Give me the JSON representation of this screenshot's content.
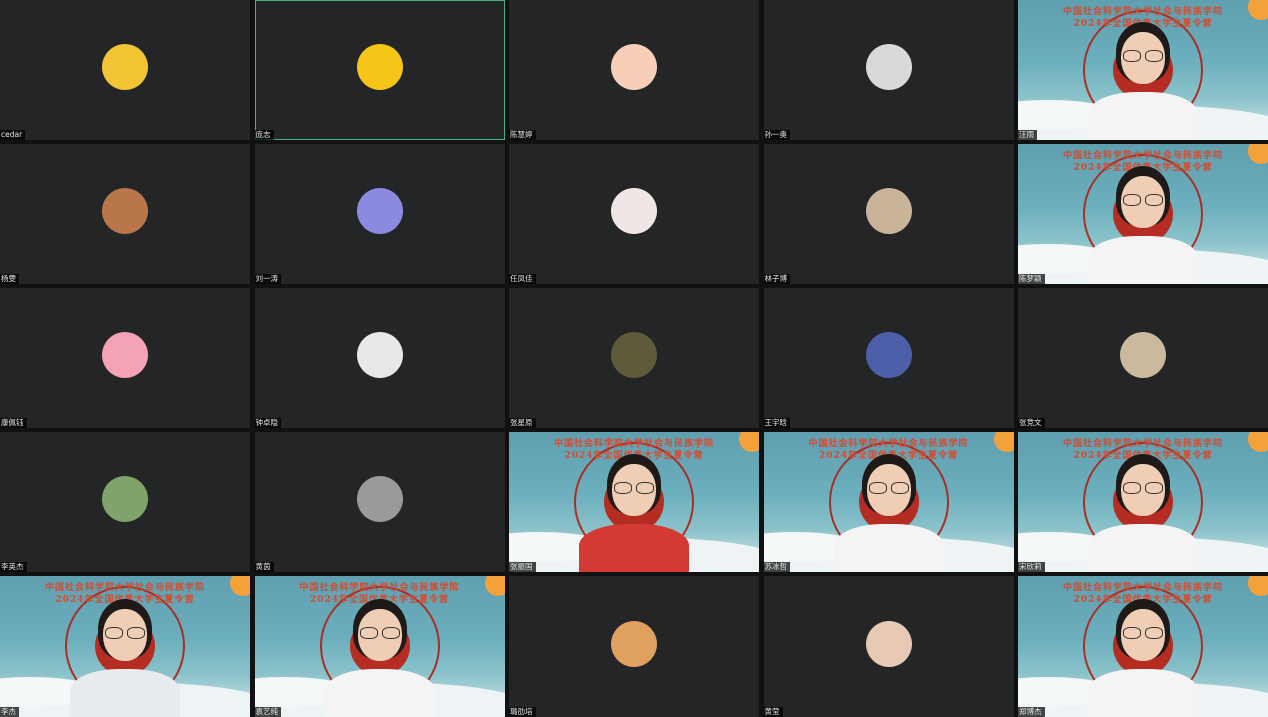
{
  "window": {
    "title": ""
  },
  "banner": {
    "line1": "中国社会科学院大学社会与民族学院",
    "line2": "2024年全国优秀大学生夏令营"
  },
  "participants": [
    {
      "name": "cedar",
      "type": "avatar",
      "avatar": "smile-emoji",
      "color": "#f2c535"
    },
    {
      "name": "庞志",
      "type": "avatar",
      "avatar": "cartoon-face",
      "color": "#f5c518",
      "active": true
    },
    {
      "name": "陈慧婷",
      "type": "avatar",
      "avatar": "anime-girl",
      "color": "#f7cfb8"
    },
    {
      "name": "孙一奥",
      "type": "avatar",
      "avatar": "default-person",
      "color": "#d9d9d9"
    },
    {
      "name": "汪雨",
      "type": "video"
    },
    {
      "name": "杨雯",
      "type": "avatar",
      "avatar": "portrait-photo",
      "color": "#b8764a"
    },
    {
      "name": "刘一涛",
      "type": "avatar",
      "avatar": "galaxy",
      "color": "#8c8ae0"
    },
    {
      "name": "任凤佳",
      "type": "avatar",
      "avatar": "anime-girl",
      "color": "#f1e6e6"
    },
    {
      "name": "林子博",
      "type": "avatar",
      "avatar": "boy-photo",
      "color": "#c9b49a"
    },
    {
      "name": "陈梦颖",
      "type": "video"
    },
    {
      "name": "康佩钰",
      "type": "avatar",
      "avatar": "pink-anime",
      "color": "#f4a3b7"
    },
    {
      "name": "钟卓隐",
      "type": "avatar",
      "avatar": "white-dog",
      "color": "#e8e8e8"
    },
    {
      "name": "张星原",
      "type": "avatar",
      "avatar": "portrait-painting",
      "color": "#5e5a3a"
    },
    {
      "name": "王宇晗",
      "type": "avatar",
      "avatar": "football-player",
      "color": "#4d5fa8"
    },
    {
      "name": "张竞文",
      "type": "avatar",
      "avatar": "cat-photo",
      "color": "#cbb99e"
    },
    {
      "name": "李英杰",
      "type": "avatar",
      "avatar": "girl-photo",
      "color": "#7fa36a"
    },
    {
      "name": "黄茵",
      "type": "avatar",
      "avatar": "astronaut",
      "color": "#9a9a9a"
    },
    {
      "name": "张振国",
      "type": "video",
      "variant": "red"
    },
    {
      "name": "苏冰哲",
      "type": "video"
    },
    {
      "name": "宋欣莉",
      "type": "video"
    },
    {
      "name": "李杰",
      "type": "video",
      "variant": "dark"
    },
    {
      "name": "袁艺纯",
      "type": "video"
    },
    {
      "name": "璐劭培",
      "type": "avatar",
      "avatar": "lion",
      "color": "#e0a060"
    },
    {
      "name": "黄莹",
      "type": "avatar",
      "avatar": "girl-cartoon",
      "color": "#e8c9b5"
    },
    {
      "name": "郑博杰",
      "type": "video"
    }
  ]
}
